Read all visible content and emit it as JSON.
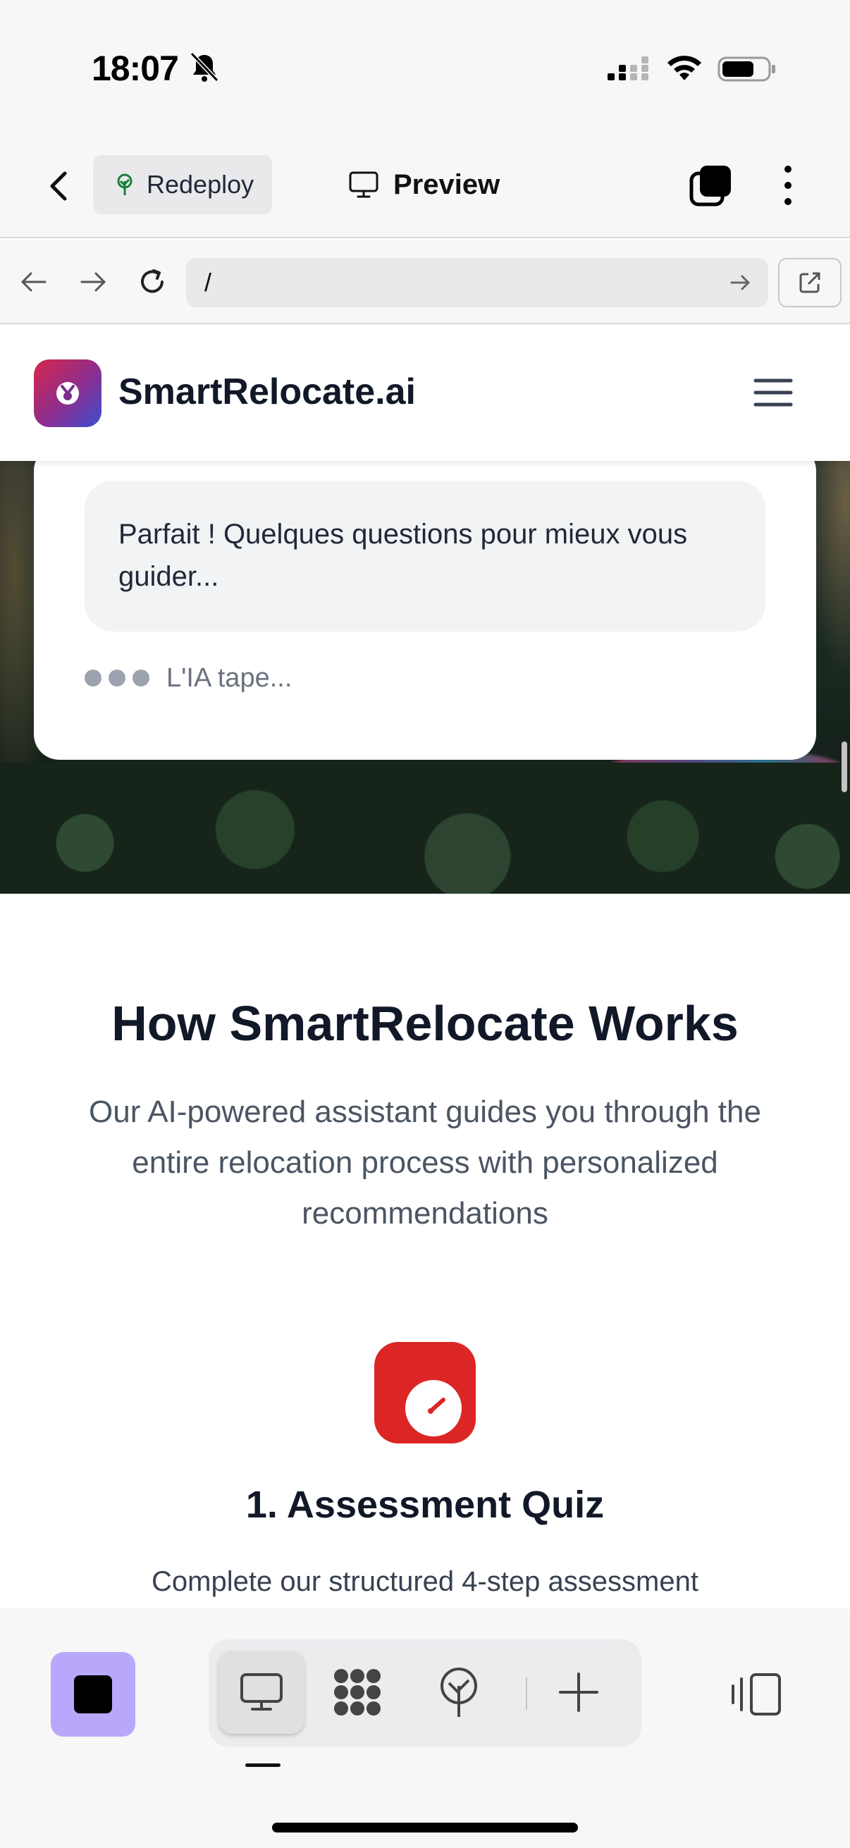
{
  "status_bar": {
    "time": "18:07"
  },
  "app_toolbar": {
    "redeploy_label": "Redeploy",
    "preview_label": "Preview"
  },
  "browser": {
    "url": "/"
  },
  "site": {
    "brand": "SmartRelocate.ai",
    "chat": {
      "message": "Parfait ! Quelques questions pour mieux vous guider...",
      "typing_label": "L'IA tape..."
    },
    "how_it_works": {
      "title": "How SmartRelocate Works",
      "subtitle": "Our AI-powered assistant guides you through the entire relocation process with personalized recommendations",
      "step1_title": "1. Assessment Quiz",
      "step1_desc": "Complete our structured 4-step assessment"
    }
  },
  "colors": {
    "accent_purple": "#b8a7fb",
    "quiz_red": "#dc2626"
  },
  "icons": [
    "bell-slash-icon",
    "signal-icon",
    "wifi-icon",
    "battery-icon",
    "back-chevron-icon",
    "tree-icon",
    "monitor-icon",
    "tabs-icon",
    "more-vertical-icon",
    "arrow-left-icon",
    "arrow-right-icon",
    "reload-icon",
    "external-link-icon",
    "hamburger-icon",
    "gauge-icon",
    "stop-icon",
    "apps-icon",
    "deploy-icon",
    "plus-icon",
    "panel-icon"
  ]
}
